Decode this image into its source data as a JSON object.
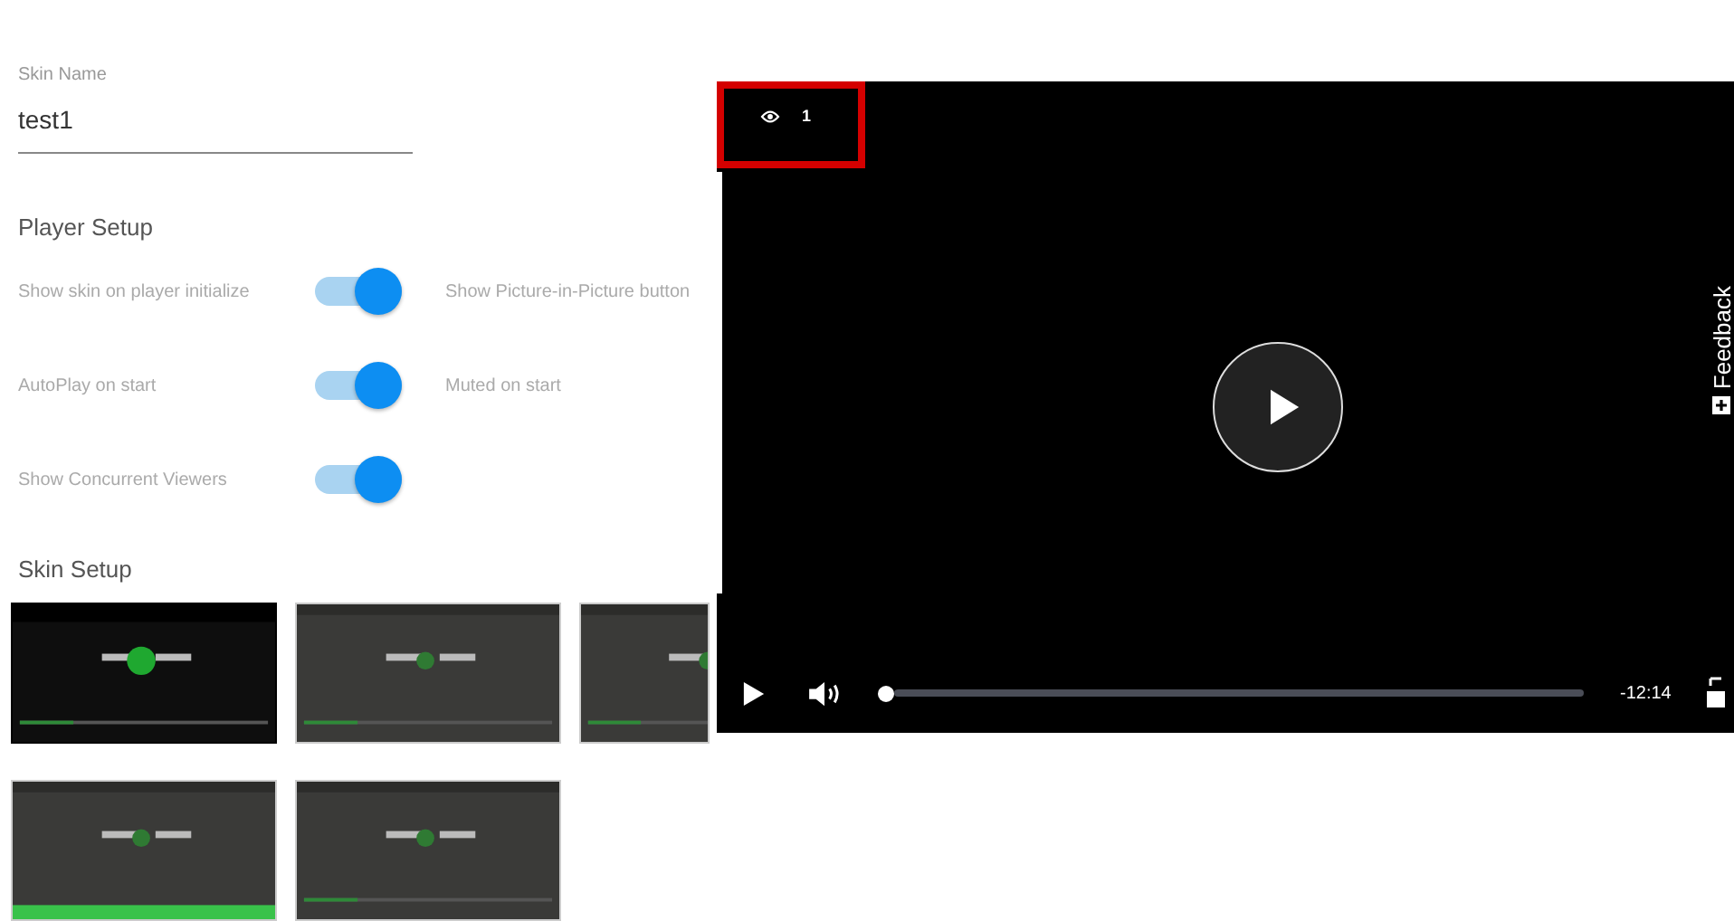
{
  "skin_name": {
    "label": "Skin Name",
    "value": "test1"
  },
  "player_setup": {
    "title": "Player Setup",
    "options": [
      {
        "label": "Show skin on player initialize",
        "kind": "toggle",
        "on": true
      },
      {
        "label": "Show Picture-in-Picture button",
        "kind": "label"
      },
      {
        "label": "AutoPlay on start",
        "kind": "toggle",
        "on": true
      },
      {
        "label": "Muted on start",
        "kind": "label"
      },
      {
        "label": "Show Concurrent Viewers",
        "kind": "toggle",
        "on": true
      }
    ]
  },
  "skin_setup": {
    "title": "Skin Setup",
    "skins": [
      {
        "kind": "dark",
        "selected": true
      },
      {
        "kind": "grey",
        "selected": false
      },
      {
        "kind": "grey",
        "selected": false
      },
      {
        "kind": "greenbar",
        "selected": false
      },
      {
        "kind": "grey",
        "selected": false
      }
    ]
  },
  "player": {
    "viewers": {
      "count": "1",
      "highlighted": true
    },
    "progress": {
      "level": 0
    },
    "time": "-12:14",
    "feedback": "Feedback"
  }
}
